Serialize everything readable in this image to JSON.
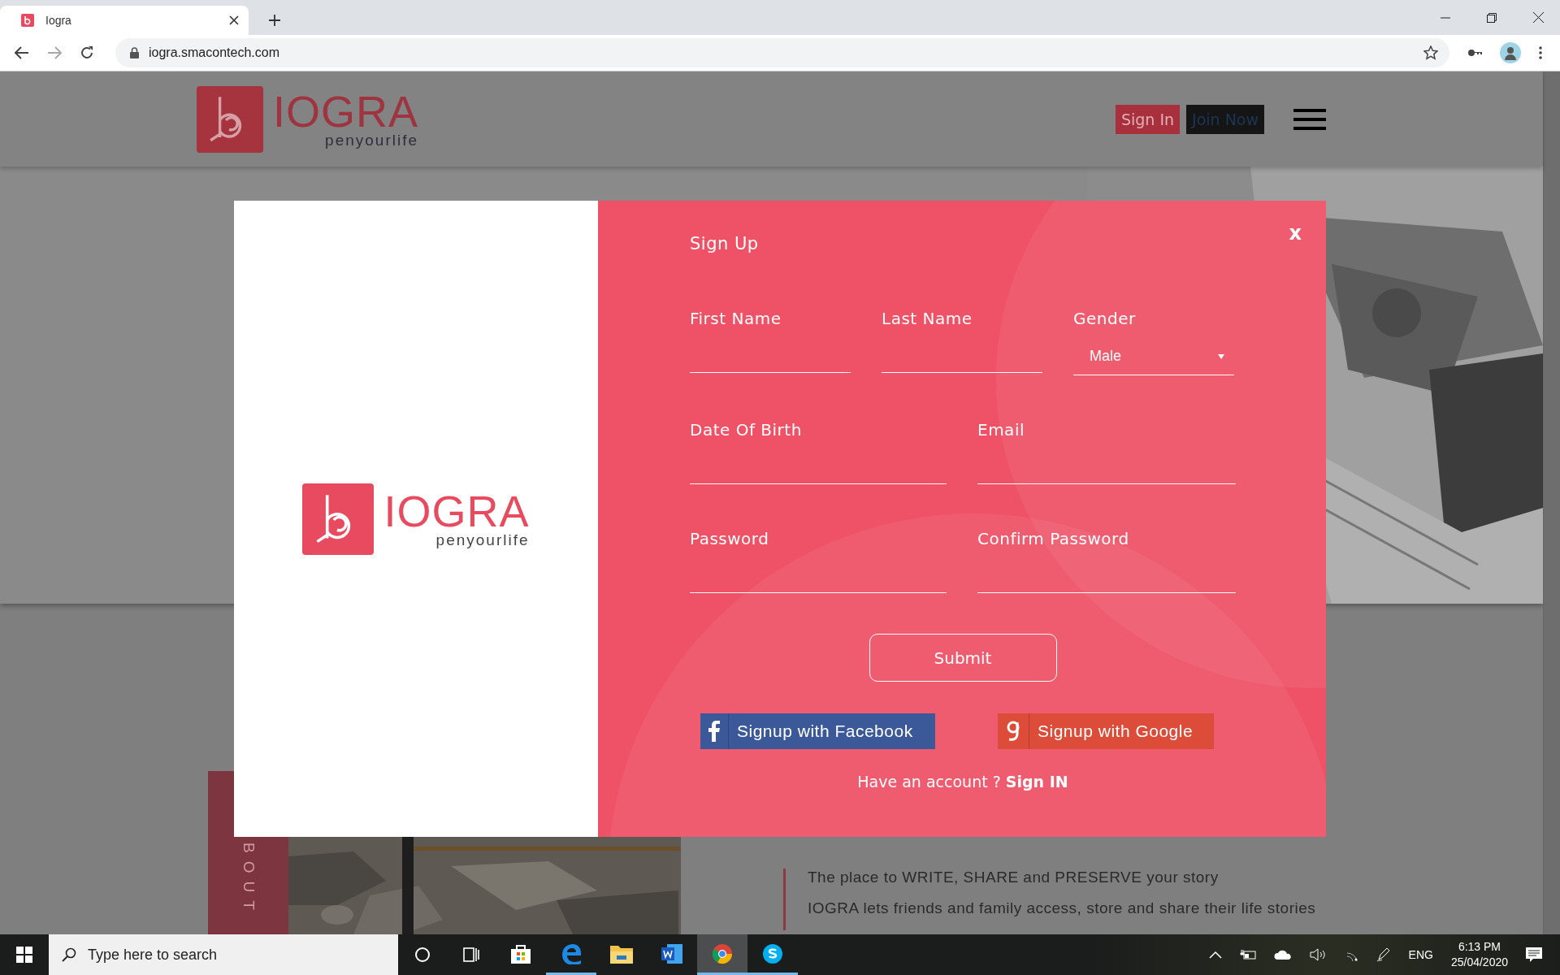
{
  "browser": {
    "tab_title": "Iogra",
    "url": "iogra.smacontech.com"
  },
  "site": {
    "logo": {
      "name": "IOGRA",
      "tagline": "penyourlife"
    },
    "header_buttons": [
      {
        "label": "Sign In",
        "kind": "primary"
      },
      {
        "label": "Join Now",
        "kind": "dark"
      }
    ],
    "about": {
      "side_label": "BOUT",
      "paragraphs": [
        "The place to WRITE, SHARE and PRESERVE your story",
        "IOGRA lets friends and family access, store and share their life stories"
      ]
    }
  },
  "modal": {
    "logo": {
      "name": "IOGRA",
      "tagline": "penyourlife"
    },
    "title": "Sign Up",
    "close": "x",
    "rows": [
      [
        {
          "label": "First Name",
          "kind": "text"
        },
        {
          "label": "Last Name",
          "kind": "text"
        },
        {
          "label": "Gender",
          "kind": "select",
          "value": "Male"
        }
      ],
      [
        {
          "label": "Date Of Birth",
          "kind": "text"
        },
        {
          "label": "Email",
          "kind": "text"
        }
      ],
      [
        {
          "label": "Password",
          "kind": "text"
        },
        {
          "label": "Confirm Password",
          "kind": "text"
        }
      ]
    ],
    "submit": "Submit",
    "social": [
      {
        "label": "Signup with Facebook",
        "kind": "facebook"
      },
      {
        "label": "Signup with Google",
        "kind": "google"
      }
    ],
    "prompt": "Have an account ?",
    "link": "Sign IN"
  },
  "taskbar": {
    "search": {
      "placeholder": "Type here to search"
    },
    "apps": [
      {
        "kind": "store",
        "running": false,
        "selected": false
      },
      {
        "kind": "edge",
        "running": true,
        "selected": false
      },
      {
        "kind": "files",
        "running": false,
        "selected": false
      },
      {
        "kind": "word",
        "running": false,
        "selected": false
      },
      {
        "kind": "chrome",
        "running": true,
        "selected": true
      },
      {
        "kind": "skype",
        "running": true,
        "selected": false
      }
    ],
    "language": "ENG",
    "time": "6:13 PM",
    "date": "25/04/2020"
  }
}
